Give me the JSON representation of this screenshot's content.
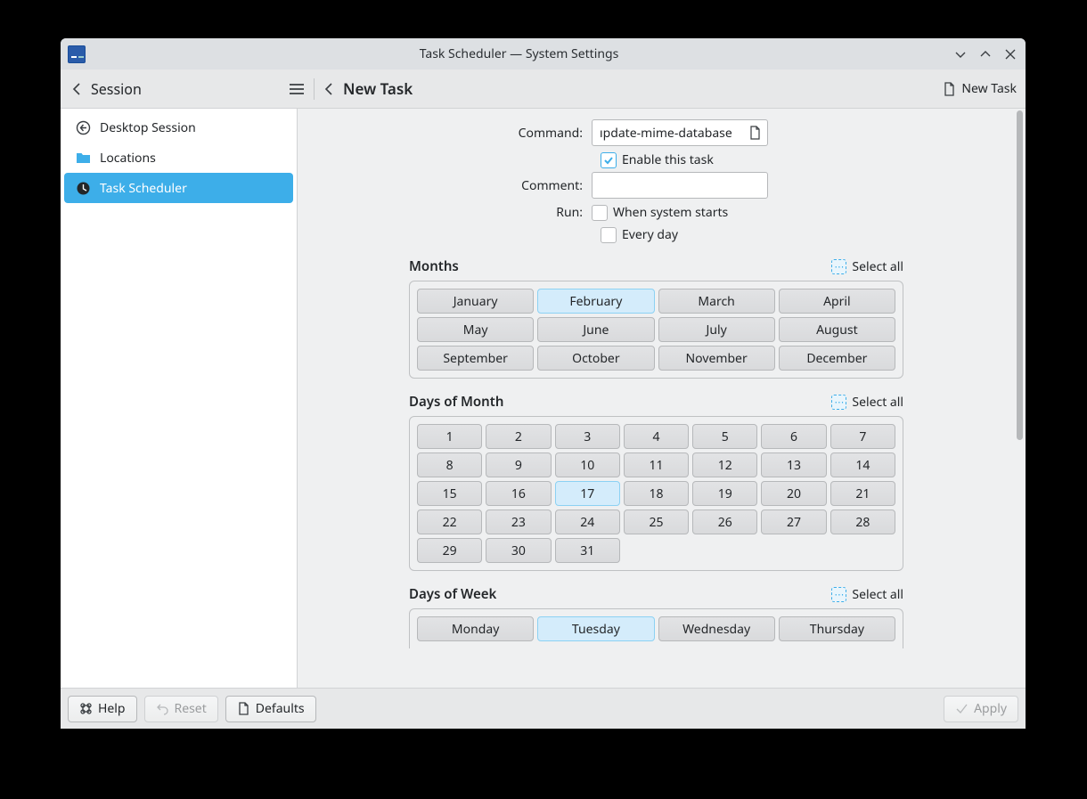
{
  "title": "Task Scheduler — System Settings",
  "nav_section": "Session",
  "page_title": "New Task",
  "new_task_label": "New Task",
  "sidebar": {
    "items": [
      {
        "label": "Desktop Session",
        "icon": "logout-icon"
      },
      {
        "label": "Locations",
        "icon": "folder-icon"
      },
      {
        "label": "Task Scheduler",
        "icon": "clock-icon",
        "selected": true
      }
    ]
  },
  "labels": {
    "command": "Command:",
    "comment": "Comment:",
    "run": "Run:",
    "enable_task": "Enable this task",
    "when_starts": "When system starts",
    "every_day": "Every day",
    "months": "Months",
    "days_of_month": "Days of Month",
    "days_of_week": "Days of Week",
    "select_all": "Select all"
  },
  "command_value": "update-mime-database",
  "command_display": "ıpdate-mime-database",
  "comment_value": "",
  "enable_checked": true,
  "when_starts_checked": false,
  "every_day_checked": false,
  "months": [
    "January",
    "February",
    "March",
    "April",
    "May",
    "June",
    "July",
    "August",
    "September",
    "October",
    "November",
    "December"
  ],
  "months_selected": [
    "February"
  ],
  "days": [
    "1",
    "2",
    "3",
    "4",
    "5",
    "6",
    "7",
    "8",
    "9",
    "10",
    "11",
    "12",
    "13",
    "14",
    "15",
    "16",
    "17",
    "18",
    "19",
    "20",
    "21",
    "22",
    "23",
    "24",
    "25",
    "26",
    "27",
    "28",
    "29",
    "30",
    "31"
  ],
  "days_selected": [
    "17"
  ],
  "weekdays": [
    "Monday",
    "Tuesday",
    "Wednesday",
    "Thursday"
  ],
  "weekdays_selected": [
    "Tuesday"
  ],
  "footer": {
    "help": "Help",
    "reset": "Reset",
    "defaults": "Defaults",
    "apply": "Apply"
  }
}
